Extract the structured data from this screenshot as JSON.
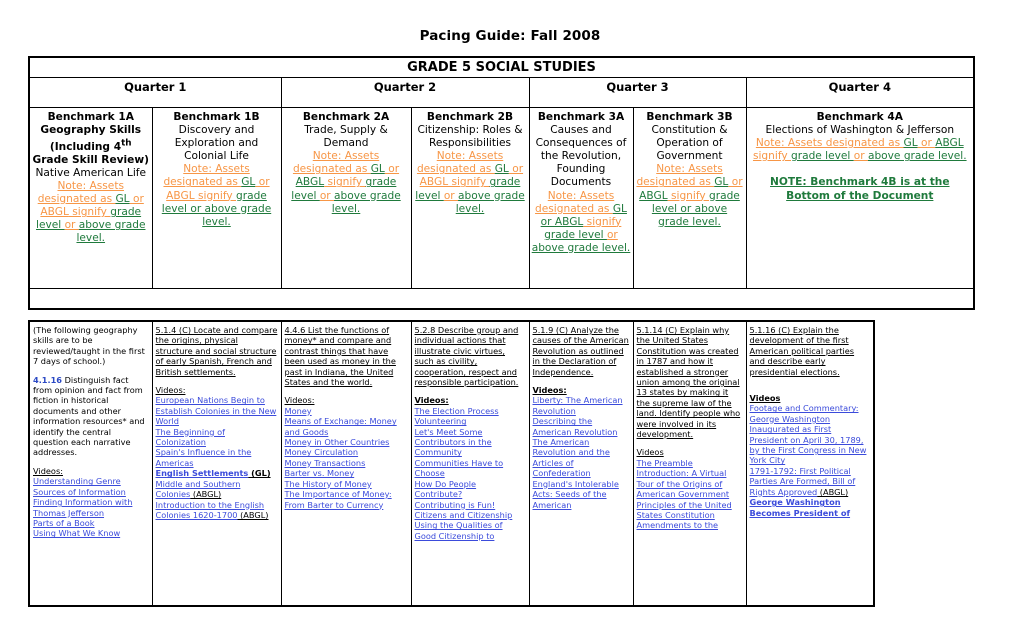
{
  "document": {
    "title": "Pacing Guide:  Fall 2008",
    "grade_band": "GRADE 5 SOCIAL STUDIES"
  },
  "colors": {
    "orange": "#F79646",
    "green": "#1F7A3C",
    "link_blue": "#3B4BDB",
    "standard_blue": "#2B49C4"
  },
  "quarters": [
    {
      "label": "Quarter 1"
    },
    {
      "label": "Quarter 2"
    },
    {
      "label": "Quarter 3"
    },
    {
      "label": "Quarter 4"
    }
  ],
  "benchmarks": [
    {
      "id": "Benchmark 1A",
      "subtitle": "Geography Skills (Including 4th Grade Skill Review)",
      "subtitle2": "Native American Life",
      "note": "Note: Assets designated as GL or ABGL signify grade level or above grade level."
    },
    {
      "id": "Benchmark 1B",
      "subtitle": "Discovery and Exploration and Colonial Life",
      "note": "Note: Assets designated as GL or ABGL signify grade level or above grade level."
    },
    {
      "id": "Benchmark 2A",
      "subtitle": "Trade, Supply & Demand",
      "note": "Note: Assets designated as GL or ABGL signify grade level or above grade level."
    },
    {
      "id": "Benchmark 2B",
      "subtitle": "Citizenship:  Roles & Responsibilities",
      "note": "Note: Assets designated as GL or ABGL signify grade level or above grade level."
    },
    {
      "id": "Benchmark 3A",
      "subtitle": "Causes and Consequences of the Revolution, Founding Documents",
      "note": "Note: Assets designated as GL or ABGL signify grade level or above grade level."
    },
    {
      "id": "Benchmark 3B",
      "subtitle": "Constitution & Operation of Government",
      "note": "Note: Assets designated as GL or ABGL signify grade level or above grade level."
    },
    {
      "id": "Benchmark 4A",
      "subtitle": "Elections of Washington & Jefferson",
      "note": "Note: Assets designated as GL or ABGL signify grade level or above grade level.",
      "extra_note": "NOTE: Benchmark 4B is at the Bottom of the Document"
    }
  ],
  "content_columns": [
    {
      "intro": "(The following geography skills are to be reviewed/taught in the first 7 days of school.)",
      "standard_code": "4.1.16",
      "standard_text": " Distinguish fact from opinion and fact from fiction in historical documents and other information resources* and identify the central question each narrative addresses.",
      "videos_label": "Videos:",
      "videos": [
        {
          "text": "Understanding Genre"
        },
        {
          "text": "Sources of Information"
        },
        {
          "text": "Finding Information with Thomas Jefferson"
        },
        {
          "text": "Parts of a Book"
        },
        {
          "text": "Using What We Know"
        }
      ]
    },
    {
      "standard_text": "5.1.4 (C) Locate and compare the origins, physical structure and social structure of early Spanish, French and British settlements.",
      "videos_label": "Videos:",
      "videos": [
        {
          "text": "European Nations Begin to Establish Colonies in the New World"
        },
        {
          "text": "The Beginning of Colonization"
        },
        {
          "text": "Spain's Influence in the Americas  "
        },
        {
          "text": "English Settlements",
          "bold": true,
          "tag": " (GL)",
          "tag_bold": true
        },
        {
          "text": "Middle and Southern Colonies",
          "tag": "  (ABGL)"
        },
        {
          "text": "Introduction to the English Colonies 1620-1700",
          "tag": "  (ABGL)"
        }
      ]
    },
    {
      "standard_text": "4.4.6 List the functions of money* and compare and contrast things that have been used as money in the past in Indiana, the United States and the world.",
      "videos_label": "Videos:",
      "videos": [
        {
          "text": "Money"
        },
        {
          "text": "Means of Exchange:  Money and Goods"
        },
        {
          "text": "Money in Other Countries"
        },
        {
          "text": "Money Circulation"
        },
        {
          "text": "Money Transactions"
        },
        {
          "text": "Barter vs. Money"
        },
        {
          "text": "The History of Money"
        },
        {
          "text": "The Importance of Money: From Barter to Currency"
        }
      ]
    },
    {
      "standard_text": "5.2.8 Describe group and individual actions that illustrate civic virtues, such as civility, cooperation, respect and responsible participation.",
      "videos_label": "Videos:",
      "videos_label_bold": true,
      "videos": [
        {
          "text": "The Election Process"
        },
        {
          "text": "Volunteering"
        },
        {
          "text": "Let's Meet Some Contributors in the Community"
        },
        {
          "text": "Communities Have to Choose"
        },
        {
          "text": "How Do People Contribute?"
        },
        {
          "text": "Contributing is Fun!"
        },
        {
          "text": "Citizens and Citizenship"
        },
        {
          "text": "Using the Qualities of Good Citizenship to "
        }
      ]
    },
    {
      "standard_text": "5.1.9 (C) Analyze the causes of the American Revolution as outlined in the Declaration of Independence.",
      "videos_label": "Videos:",
      "videos_label_bold": true,
      "videos": [
        {
          "text": "Liberty: The American Revolution "
        },
        {
          "text": "Describing the American Revolution"
        },
        {
          "text": "The American Revolution and the Articles of Confederation  "
        },
        {
          "text": "England's Intolerable Acts:  Seeds of the American"
        }
      ]
    },
    {
      "standard_text": "5.1.14 (C) Explain why the United States Constitution was created in 1787 and how it established a stronger union among the original 13 states by making it the supreme law of the land. Identify people who were involved in its development.",
      "videos_label": "Videos",
      "videos": [
        {
          "text": "The Preamble  "
        },
        {
          "text": "Introduction: A Virtual Tour of the Origins of American Government  "
        },
        {
          "text": "Principles of the United States Constitution "
        },
        {
          "text": "Amendments to the "
        }
      ]
    },
    {
      "standard_text": "5.1.16 (C) Explain the development of the first American political parties and describe early presidential elections.",
      "videos_label": "Videos",
      "videos_label_bold": true,
      "videos": [
        {
          "text": "Footage and Commentary: George Washington Inaugurated as First President on April 30, 1789, by the First Congress in New York City  "
        },
        {
          "text": "1791-1792: First Political Parties Are Formed, Bill of Rights Approved",
          "tag": "  (ABGL)"
        },
        {
          "text": "George Washington Becomes President of",
          "bold": true
        }
      ]
    }
  ]
}
